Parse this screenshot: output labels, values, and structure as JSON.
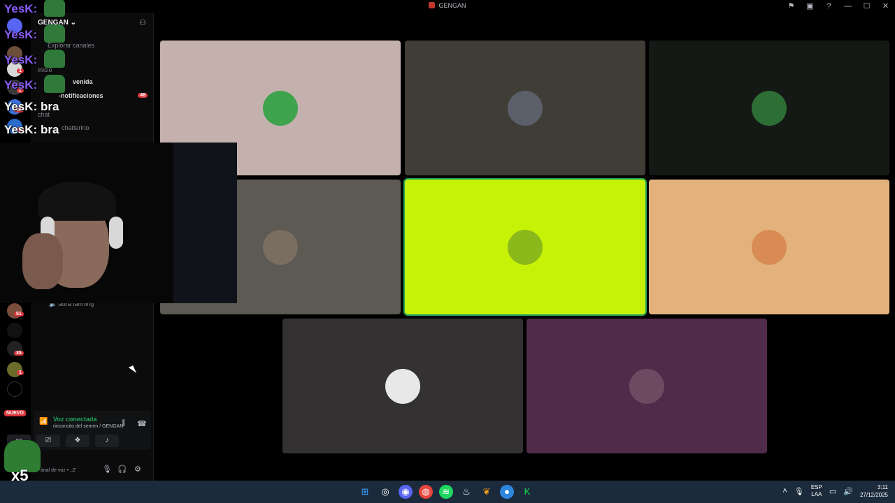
{
  "window": {
    "title": "GENGAN",
    "controls": [
      "⚑",
      "▣",
      "?",
      "—",
      "☐",
      "✕"
    ]
  },
  "rail": {
    "badges": [
      "1",
      "2",
      "23",
      "1",
      "51",
      "35",
      "1"
    ],
    "new_label": "NUEVO"
  },
  "sidebar": {
    "server_name": "GENGAN",
    "browse_channels": "Explorar canales",
    "category_inicio": "inicio",
    "channel_bienvenida": "venida",
    "channel_notificaciones": "-notificaciones",
    "notificaciones_badge": "46",
    "category_chat": "chat",
    "channel_chatterino": "chatterino",
    "channel_aura": "aura farming"
  },
  "voice": {
    "status": "Voz conectada",
    "location": "rinconcito del semen / GENGAN",
    "user_status": "anal de voz • ,;Z"
  },
  "chat_overlay": {
    "lines": [
      "YesK:",
      "YesK:",
      "YesK:",
      "YesK:",
      "YesK: bra",
      "YesK: bra"
    ],
    "multiplier": "x5"
  },
  "tiles": [
    {
      "bg": "#c4b1ae",
      "avatar": "#3fa34d"
    },
    {
      "bg": "#403d37",
      "avatar": "#5a5f6a"
    },
    {
      "bg": "#151915",
      "avatar": "#2c6e34"
    },
    {
      "bg": "#5c5a52",
      "avatar": "#7a6e62"
    },
    {
      "bg": "#c6f208",
      "avatar": "#8bb81a"
    },
    {
      "bg": "#e3b27c",
      "avatar": "#d98b54"
    },
    {
      "bg": "#333132",
      "avatar": "#e8e8e8"
    },
    {
      "bg": "#512b4a",
      "avatar": "#6e4a62"
    }
  ],
  "taskbar": {
    "lang_top": "ESP",
    "lang_bottom": "LAA",
    "time": "3:11",
    "date": "27/12/2025"
  },
  "colors": {
    "accent_green": "#23a55a",
    "badge_red": "#da373c",
    "username_purple": "#8b5cf6"
  }
}
